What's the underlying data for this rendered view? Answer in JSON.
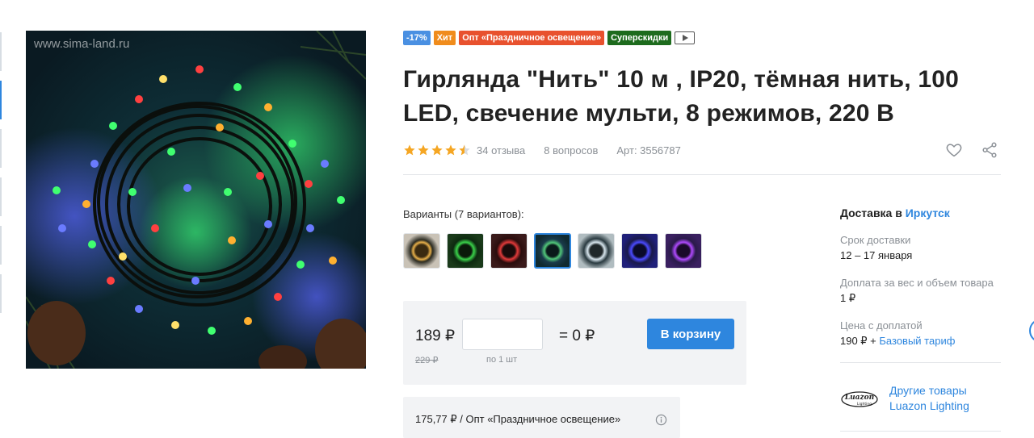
{
  "photo": {
    "watermark": "www.sima-land.ru"
  },
  "badges": [
    {
      "label": "-17%",
      "color": "#4a90e2"
    },
    {
      "label": "Хит",
      "color": "#f08c1c"
    },
    {
      "label": "Опт «Праздничное освещение»",
      "color": "#e8512e"
    },
    {
      "label": "Суперскидки",
      "color": "#1d6b1d"
    }
  ],
  "product": {
    "title": "Гирлянда \"Нить\" 10 м , IP20, тёмная нить, 100 LED, свечение мульти, 8 режимов, 220 В",
    "rating": 4.5,
    "reviews": "34 отзыва",
    "questions": "8 вопросов",
    "sku": "Арт: 3556787"
  },
  "variants": {
    "label": "Варианты (7 вариантов):",
    "items": [
      {
        "name": "warm-white",
        "color": "#e8b04a"
      },
      {
        "name": "green",
        "color": "#3ad24a"
      },
      {
        "name": "red",
        "color": "#e23a3a"
      },
      {
        "name": "multi",
        "color": "#52c87a"
      },
      {
        "name": "white-multi",
        "color": "#d8e6ee"
      },
      {
        "name": "blue",
        "color": "#4a4aff"
      },
      {
        "name": "purple",
        "color": "#b04aff"
      }
    ]
  },
  "buy": {
    "price": "189 ₽",
    "old_price": "229 ₽",
    "qty_hint": "по 1 шт",
    "total": "= 0 ₽",
    "cart_label": "В корзину"
  },
  "wholesale": {
    "text": "175,77 ₽ / Опт «Праздничное освещение»"
  },
  "delivery": {
    "title_prefix": "Доставка в ",
    "city": "Иркутск",
    "term_label": "Срок доставки",
    "term_value": "12 – 17 января",
    "surcharge_label": "Доплата за вес и объем товара",
    "surcharge_value": "1 ₽",
    "price_label": "Цена с доплатой",
    "price_value": "190 ₽ + ",
    "tariff": "Базовый тариф"
  },
  "brand": {
    "logo_text": "Luazon",
    "logo_sub": "Lighting",
    "link": "Другие товары Luazon Lighting"
  },
  "colors": {
    "accent": "#2e86de",
    "star": "#f5a623"
  }
}
